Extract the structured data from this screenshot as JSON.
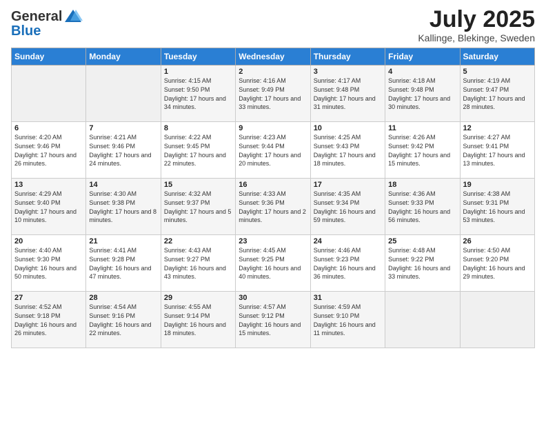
{
  "header": {
    "logo_general": "General",
    "logo_blue": "Blue",
    "month": "July 2025",
    "location": "Kallinge, Blekinge, Sweden"
  },
  "weekdays": [
    "Sunday",
    "Monday",
    "Tuesday",
    "Wednesday",
    "Thursday",
    "Friday",
    "Saturday"
  ],
  "weeks": [
    [
      {
        "day": "",
        "info": ""
      },
      {
        "day": "",
        "info": ""
      },
      {
        "day": "1",
        "info": "Sunrise: 4:15 AM\nSunset: 9:50 PM\nDaylight: 17 hours and 34 minutes."
      },
      {
        "day": "2",
        "info": "Sunrise: 4:16 AM\nSunset: 9:49 PM\nDaylight: 17 hours and 33 minutes."
      },
      {
        "day": "3",
        "info": "Sunrise: 4:17 AM\nSunset: 9:48 PM\nDaylight: 17 hours and 31 minutes."
      },
      {
        "day": "4",
        "info": "Sunrise: 4:18 AM\nSunset: 9:48 PM\nDaylight: 17 hours and 30 minutes."
      },
      {
        "day": "5",
        "info": "Sunrise: 4:19 AM\nSunset: 9:47 PM\nDaylight: 17 hours and 28 minutes."
      }
    ],
    [
      {
        "day": "6",
        "info": "Sunrise: 4:20 AM\nSunset: 9:46 PM\nDaylight: 17 hours and 26 minutes."
      },
      {
        "day": "7",
        "info": "Sunrise: 4:21 AM\nSunset: 9:46 PM\nDaylight: 17 hours and 24 minutes."
      },
      {
        "day": "8",
        "info": "Sunrise: 4:22 AM\nSunset: 9:45 PM\nDaylight: 17 hours and 22 minutes."
      },
      {
        "day": "9",
        "info": "Sunrise: 4:23 AM\nSunset: 9:44 PM\nDaylight: 17 hours and 20 minutes."
      },
      {
        "day": "10",
        "info": "Sunrise: 4:25 AM\nSunset: 9:43 PM\nDaylight: 17 hours and 18 minutes."
      },
      {
        "day": "11",
        "info": "Sunrise: 4:26 AM\nSunset: 9:42 PM\nDaylight: 17 hours and 15 minutes."
      },
      {
        "day": "12",
        "info": "Sunrise: 4:27 AM\nSunset: 9:41 PM\nDaylight: 17 hours and 13 minutes."
      }
    ],
    [
      {
        "day": "13",
        "info": "Sunrise: 4:29 AM\nSunset: 9:40 PM\nDaylight: 17 hours and 10 minutes."
      },
      {
        "day": "14",
        "info": "Sunrise: 4:30 AM\nSunset: 9:38 PM\nDaylight: 17 hours and 8 minutes."
      },
      {
        "day": "15",
        "info": "Sunrise: 4:32 AM\nSunset: 9:37 PM\nDaylight: 17 hours and 5 minutes."
      },
      {
        "day": "16",
        "info": "Sunrise: 4:33 AM\nSunset: 9:36 PM\nDaylight: 17 hours and 2 minutes."
      },
      {
        "day": "17",
        "info": "Sunrise: 4:35 AM\nSunset: 9:34 PM\nDaylight: 16 hours and 59 minutes."
      },
      {
        "day": "18",
        "info": "Sunrise: 4:36 AM\nSunset: 9:33 PM\nDaylight: 16 hours and 56 minutes."
      },
      {
        "day": "19",
        "info": "Sunrise: 4:38 AM\nSunset: 9:31 PM\nDaylight: 16 hours and 53 minutes."
      }
    ],
    [
      {
        "day": "20",
        "info": "Sunrise: 4:40 AM\nSunset: 9:30 PM\nDaylight: 16 hours and 50 minutes."
      },
      {
        "day": "21",
        "info": "Sunrise: 4:41 AM\nSunset: 9:28 PM\nDaylight: 16 hours and 47 minutes."
      },
      {
        "day": "22",
        "info": "Sunrise: 4:43 AM\nSunset: 9:27 PM\nDaylight: 16 hours and 43 minutes."
      },
      {
        "day": "23",
        "info": "Sunrise: 4:45 AM\nSunset: 9:25 PM\nDaylight: 16 hours and 40 minutes."
      },
      {
        "day": "24",
        "info": "Sunrise: 4:46 AM\nSunset: 9:23 PM\nDaylight: 16 hours and 36 minutes."
      },
      {
        "day": "25",
        "info": "Sunrise: 4:48 AM\nSunset: 9:22 PM\nDaylight: 16 hours and 33 minutes."
      },
      {
        "day": "26",
        "info": "Sunrise: 4:50 AM\nSunset: 9:20 PM\nDaylight: 16 hours and 29 minutes."
      }
    ],
    [
      {
        "day": "27",
        "info": "Sunrise: 4:52 AM\nSunset: 9:18 PM\nDaylight: 16 hours and 26 minutes."
      },
      {
        "day": "28",
        "info": "Sunrise: 4:54 AM\nSunset: 9:16 PM\nDaylight: 16 hours and 22 minutes."
      },
      {
        "day": "29",
        "info": "Sunrise: 4:55 AM\nSunset: 9:14 PM\nDaylight: 16 hours and 18 minutes."
      },
      {
        "day": "30",
        "info": "Sunrise: 4:57 AM\nSunset: 9:12 PM\nDaylight: 16 hours and 15 minutes."
      },
      {
        "day": "31",
        "info": "Sunrise: 4:59 AM\nSunset: 9:10 PM\nDaylight: 16 hours and 11 minutes."
      },
      {
        "day": "",
        "info": ""
      },
      {
        "day": "",
        "info": ""
      }
    ]
  ]
}
